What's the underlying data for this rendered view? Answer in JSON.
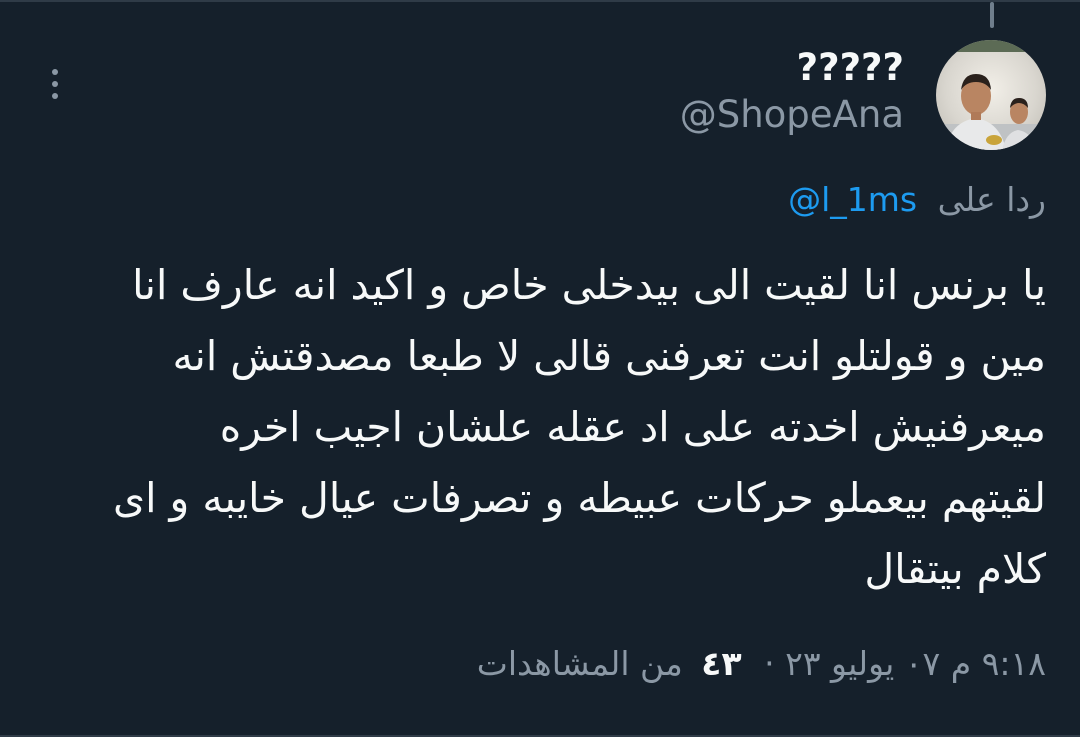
{
  "author": {
    "display_name": "?????",
    "handle": "@ShopeAna",
    "avatar_icon": "profile-photo"
  },
  "reply": {
    "prefix": "ردا على",
    "mention": "@l_1ms"
  },
  "tweet": {
    "lines": [
      "يا برنس انا لقيت الى بيدخلى خاص و اكيد انه عارف انا",
      "مين و قولتلو انت تعرفنى قالى لا طبعا مصدقتش انه",
      "ميعرفنيش اخدته على اد عقله  علشان اجيب اخره",
      "لقيتهم بيعملو حركات عبيطه و تصرفات عيال خايبه و اى",
      "كلام بيتقال"
    ]
  },
  "meta": {
    "timestamp": "٩:١٨ م ٠٧ يوليو ٢٣",
    "separator": "·",
    "views_count": "٤٣",
    "views_label": "من المشاهدات"
  },
  "colors": {
    "background": "#15202b",
    "text_primary": "#f7f9f9",
    "text_secondary": "#8b98a5",
    "accent": "#1d9bf0"
  }
}
